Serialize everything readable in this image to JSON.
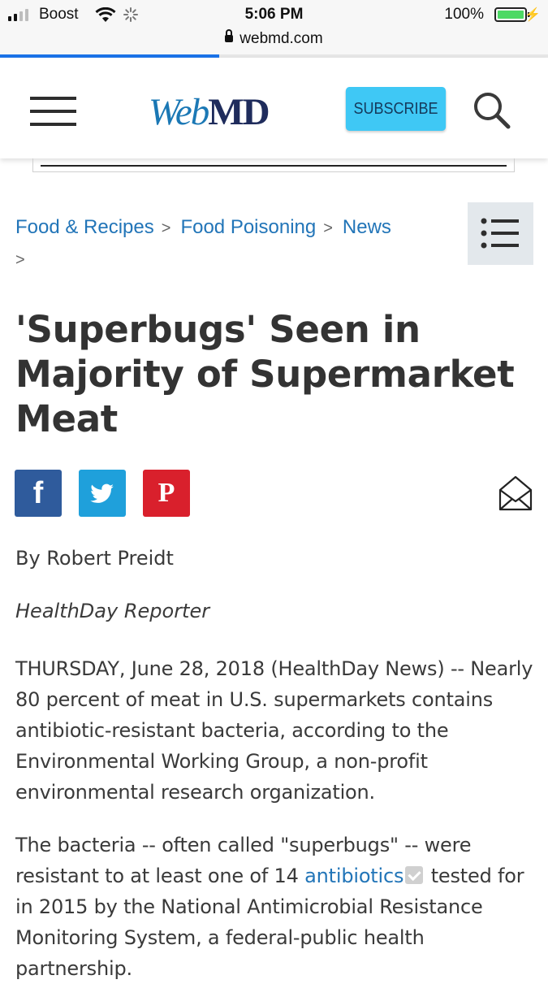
{
  "status_bar": {
    "carrier": "Boost",
    "time": "5:06 PM",
    "battery_percent": "100%",
    "icons": [
      "signal-icon",
      "wifi-icon",
      "loading-icon",
      "battery-icon",
      "charging-icon"
    ]
  },
  "browser": {
    "url": "webmd.com",
    "load_progress": 0.4
  },
  "header": {
    "logo_web": "Web",
    "logo_md": "MD",
    "subscribe_label": "SUBSCRIBE",
    "accent_color": "#3fc8f5"
  },
  "breadcrumb": {
    "items": [
      "Food & Recipes",
      "Food Poisoning",
      "News"
    ],
    "separator": ">"
  },
  "article": {
    "title": "'Superbugs' Seen in Majority of Supermarket Meat",
    "byline": "By Robert Preidt",
    "reporter": "HealthDay Reporter",
    "share": {
      "facebook": "f",
      "pinterest": "P",
      "colors": {
        "facebook": "#2f5b9c",
        "twitter": "#1fa0db",
        "pinterest": "#d9202c"
      }
    },
    "paragraph1": "THURSDAY, June 28, 2018 (HealthDay News) -- Nearly 80 percent of meat in U.S. supermarkets contains antibiotic-resistant bacteria, according to the Environmental Working Group, a non-profit environmental research organization.",
    "paragraph2_before": "The bacteria -- often called \"superbugs\" -- were resistant to at least one of 14 ",
    "paragraph2_link": "antibiotics",
    "paragraph2_after": " tested for in 2015 by the National Antimicrobial Resistance Monitoring System, a federal-public health partnership."
  }
}
